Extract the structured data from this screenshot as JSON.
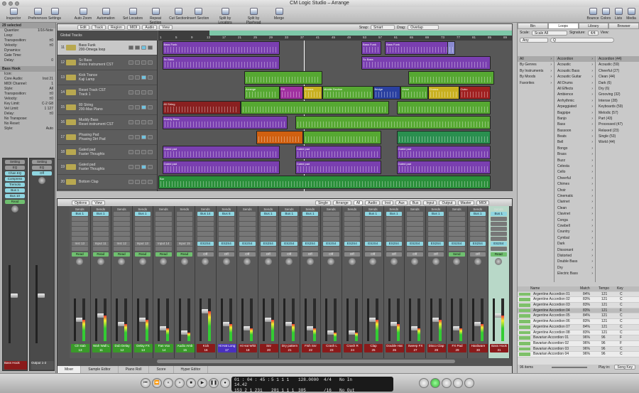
{
  "window": {
    "title": "CM Logic Studio – Arrange"
  },
  "toolbar": {
    "left": [
      "Inspector",
      "Preferences",
      "Settings",
      "Auto Zoom",
      "Automation",
      "Set Locators",
      "Repeat Section",
      "Cut Section",
      "Insert Section",
      "Split by Locators",
      "Split by Playhead",
      "Merge"
    ],
    "right": [
      "Bounce",
      "Colors",
      "Lists",
      "Media"
    ]
  },
  "inspector": {
    "region_header": "29 selected",
    "region_params": [
      [
        "Quantize:",
        "1/16-Note"
      ],
      [
        "Loop:",
        ""
      ],
      [
        "Transposition:",
        "±0"
      ],
      [
        "Velocity:",
        "±0"
      ],
      [
        "Dynamics:",
        ""
      ],
      [
        "Gate Time:",
        ""
      ],
      [
        "Delay:",
        "0"
      ]
    ],
    "track_header": "Bass Hook",
    "track_params": [
      [
        "Icon:",
        ""
      ],
      [
        "Core Audio:",
        "Inst 21"
      ],
      [
        "MIDI Channel:",
        "1"
      ],
      [
        "Style:",
        "All"
      ],
      [
        "Transposition:",
        "±0"
      ],
      [
        "Velocity:",
        "±0"
      ],
      [
        "Key Limit:",
        "C-2  G8"
      ],
      [
        "Vel Limit:",
        "1  127"
      ],
      [
        "Delay:",
        "±0"
      ],
      [
        "No Transpose:",
        ""
      ],
      [
        "No Reset:",
        ""
      ],
      [
        "Style:",
        "Auto"
      ]
    ],
    "strip_buttons": [
      "Setting",
      "EQ",
      "Chan EQ",
      "Compress",
      "Tremolo",
      "Bus 1",
      "Bus 10",
      "Read",
      "Off"
    ],
    "strip_names": [
      "Bass Hook",
      "Output 1-2"
    ]
  },
  "arrange": {
    "menus": [
      "Edit",
      "Track",
      "Region",
      "MIDI",
      "Audio",
      "View"
    ],
    "snap_label": "Snap:",
    "snap_value": "Smart",
    "drag_label": "Drag:",
    "drag_value": "Overlap",
    "global_tracks": "Global Tracks",
    "ruler": [
      "1",
      "5",
      "9",
      "13",
      "17",
      "21",
      "25",
      "29",
      "33",
      "37",
      "41",
      "45",
      "49",
      "53",
      "57",
      "61",
      "65",
      "69",
      "73",
      "77",
      "81",
      "85",
      "89"
    ],
    "tracks": [
      {
        "num": "11",
        "name": "Bass Funk",
        "sub": "200-Omega loop",
        "sel": true
      },
      {
        "num": "12",
        "name": "Sc Bass",
        "sub": "Retro Instrument CST"
      },
      {
        "num": "13",
        "name": "Kick Trance",
        "sub": "Kaji Lamp"
      },
      {
        "num": "14",
        "name": "Reset Track CST",
        "sub": "Track 1"
      },
      {
        "num": "15",
        "name": "80 String",
        "sub": "200-Max Plano"
      },
      {
        "num": "16",
        "name": "Muddy Bass",
        "sub": "Reset instrument CST"
      },
      {
        "num": "17",
        "name": "Phasing Pad",
        "sub": "Phasing Dirt Pad"
      },
      {
        "num": "18",
        "name": "Gated pad",
        "sub": "Faster Thoughts"
      },
      {
        "num": "19",
        "name": "Gated pad",
        "sub": "Faster Thoughts"
      },
      {
        "num": "20",
        "name": "Bottom Clap",
        "sub": ""
      }
    ],
    "regions": [
      {
        "track": 0,
        "start": 53,
        "len": 5,
        "color": "#7a3fb0",
        "label": "Bass Funk"
      },
      {
        "track": 0,
        "start": 59,
        "len": 18,
        "color": "#7a3fb0",
        "label": "Bass Funk"
      },
      {
        "track": 0,
        "start": 2,
        "len": 30,
        "color": "#7a3fb0",
        "label": "Bass Funk"
      },
      {
        "track": 0,
        "start": 75,
        "len": 2,
        "color": "#8a8ad0",
        "label": ""
      },
      {
        "track": 1,
        "start": 2,
        "len": 30,
        "color": "#7a3fb0",
        "label": "Sc Bass"
      },
      {
        "track": 1,
        "start": 53,
        "len": 33,
        "color": "#7a3fb0",
        "label": "Sc Bass"
      },
      {
        "track": 2,
        "start": 23,
        "len": 20,
        "color": "#56a832",
        "label": ""
      },
      {
        "track": 2,
        "start": 65,
        "len": 22,
        "color": "#56a832",
        "label": ""
      },
      {
        "track": 3,
        "start": 23,
        "len": 9,
        "color": "#56a832",
        "label": "Arrange"
      },
      {
        "track": 3,
        "start": 32,
        "len": 6,
        "color": "#a030a0",
        "label": "Fill"
      },
      {
        "track": 3,
        "start": 38,
        "len": 5,
        "color": "#c8b020",
        "label": "Chorus"
      },
      {
        "track": 3,
        "start": 43,
        "len": 13,
        "color": "#56a832",
        "label": "Middle Section"
      },
      {
        "track": 3,
        "start": 56,
        "len": 7,
        "color": "#2a40a0",
        "label": "Bridge"
      },
      {
        "track": 3,
        "start": 63,
        "len": 7,
        "color": "#56a832",
        "label": "Verse"
      },
      {
        "track": 3,
        "start": 70,
        "len": 8,
        "color": "#c8b020",
        "label": "Chorus"
      },
      {
        "track": 3,
        "start": 78,
        "len": 8,
        "color": "#a02020",
        "label": "Outro"
      },
      {
        "track": 4,
        "start": 2,
        "len": 20,
        "color": "#8a2020",
        "label": "80 String"
      },
      {
        "track": 4,
        "start": 22,
        "len": 38,
        "color": "#56a832",
        "label": ""
      },
      {
        "track": 4,
        "start": 62,
        "len": 24,
        "color": "#56a832",
        "label": ""
      },
      {
        "track": 5,
        "start": 2,
        "len": 32,
        "color": "#7a3fb0",
        "label": "Muddy Bass"
      },
      {
        "track": 5,
        "start": 36,
        "len": 50,
        "color": "#56a832",
        "label": ""
      },
      {
        "track": 6,
        "start": 26,
        "len": 12,
        "color": "#d06010",
        "label": ""
      },
      {
        "track": 6,
        "start": 38,
        "len": 20,
        "color": "#56a832",
        "label": ""
      },
      {
        "track": 6,
        "start": 62,
        "len": 24,
        "color": "#2a8f4f",
        "label": ""
      },
      {
        "track": 7,
        "start": 2,
        "len": 30,
        "color": "#7a3fb0",
        "label": "Gated pad"
      },
      {
        "track": 7,
        "start": 36,
        "len": 22,
        "color": "#7a3fb0",
        "label": "Gated pad"
      },
      {
        "track": 7,
        "start": 62,
        "len": 24,
        "color": "#7a3fb0",
        "label": "Gated pad"
      },
      {
        "track": 8,
        "start": 2,
        "len": 30,
        "color": "#7a3fb0",
        "label": "Gated pad"
      },
      {
        "track": 8,
        "start": 36,
        "len": 22,
        "color": "#7a3fb0",
        "label": "Gated pad"
      },
      {
        "track": 8,
        "start": 62,
        "len": 24,
        "color": "#7a3fb0",
        "label": "Gated pad"
      },
      {
        "track": 9,
        "start": 1,
        "len": 85,
        "color": "#2a8f3a",
        "label": "Bar"
      }
    ]
  },
  "mixer": {
    "menus": [
      "Options",
      "View"
    ],
    "filters": [
      "Single",
      "Arrange",
      "All",
      "Audio",
      "Inst",
      "Aux",
      "Bus",
      "Input",
      "Output",
      "Master",
      "MIDI"
    ],
    "sends_label": "Sends",
    "tabs": [
      "Mixer",
      "Sample Editor",
      "Piano Roll",
      "Score",
      "Hyper Editor"
    ],
    "channels": [
      {
        "name": "Clr stab",
        "num": "13",
        "color": "#3a9a2a",
        "bus": "Bus 1",
        "io": "Inst 13",
        "auto": "Read",
        "level": 0.5
      },
      {
        "name": "Wah Wall L",
        "num": "11",
        "color": "#3a9a2a",
        "bus": "Bus 1",
        "io": "Input 11",
        "auto": "Read",
        "level": 0.6
      },
      {
        "name": "Dub Delay",
        "num": "12",
        "color": "#3a9a2a",
        "bus": "",
        "io": "Inst 12",
        "auto": "Read",
        "level": 0.4
      },
      {
        "name": "Delay FX",
        "num": "13",
        "color": "#3a9a2a",
        "bus": "Bus 1",
        "io": "Input 13",
        "auto": "Read",
        "level": 0.5
      },
      {
        "name": "Fan Vox",
        "num": "14",
        "color": "#3a9a2a",
        "bus": "",
        "io": "Input 14",
        "auto": "Read",
        "level": 0.3
      },
      {
        "name": "Audio Amb",
        "num": "15",
        "color": "#3a9a2a",
        "bus": "",
        "io": "Input 15",
        "auto": "Read",
        "level": 0.2
      },
      {
        "name": "Kick",
        "num": "16",
        "color": "#8a1a1a",
        "bus": "Bus 14",
        "io": "ES2S4",
        "auto": "Off",
        "level": 0.7
      },
      {
        "name": "Hi Hat Long",
        "num": "17",
        "color": "#4a30c0",
        "bus": "Bus 8",
        "io": "ES2S4",
        "auto": "Off",
        "level": 0.4
      },
      {
        "name": "Hi Hat Whit",
        "num": "18",
        "color": "#8a1a1a",
        "bus": "",
        "io": "ES2S4",
        "auto": "Off",
        "level": 0.3
      },
      {
        "name": "Snr",
        "num": "20",
        "color": "#8a1a1a",
        "bus": "Bus 1",
        "io": "ES2S4",
        "auto": "Off",
        "level": 0.5
      },
      {
        "name": "Dry pattern",
        "num": "21",
        "color": "#8a1a1a",
        "bus": "Bus 1",
        "io": "ES2S4",
        "auto": "Off",
        "level": 0.4
      },
      {
        "name": "Fish Snr",
        "num": "22",
        "color": "#8a1a1a",
        "bus": "Bus 1",
        "io": "ES2S4",
        "auto": "Off",
        "level": 0.3
      },
      {
        "name": "Crash L",
        "num": "23",
        "color": "#8a1a1a",
        "bus": "",
        "io": "ES2S4",
        "auto": "Off",
        "level": 0.2
      },
      {
        "name": "Crash R",
        "num": "24",
        "color": "#8a1a1a",
        "bus": "",
        "io": "ES2S4",
        "auto": "Off",
        "level": 0.2
      },
      {
        "name": "Clap",
        "num": "25",
        "color": "#8a1a1a",
        "bus": "Bus 1",
        "io": "ES2S4",
        "auto": "Off",
        "level": 0.5
      },
      {
        "name": "Double Hat",
        "num": "26",
        "color": "#8a1a1a",
        "bus": "Bus 1",
        "io": "ES2S4",
        "auto": "Off",
        "level": 0.4
      },
      {
        "name": "Sweep FX",
        "num": "27",
        "color": "#8a1a1a",
        "bus": "",
        "io": "ES2S4",
        "auto": "Off",
        "level": 0.3
      },
      {
        "name": "Disco Clap",
        "num": "28",
        "color": "#8a1a1a",
        "bus": "Bus 1",
        "io": "ES2S4",
        "auto": "Off",
        "level": 0.5
      },
      {
        "name": "FX Pad",
        "num": "29",
        "color": "#8a1a1a",
        "bus": "",
        "io": "ES2S4",
        "auto": "Send",
        "level": 0.3
      },
      {
        "name": "Hardware",
        "num": "30",
        "color": "#8a1a1a",
        "bus": "Bus 1",
        "io": "ES2S4",
        "auto": "Off",
        "level": 0.4
      },
      {
        "name": "Bass Hook",
        "num": "31",
        "color": "#8a1a1a",
        "bus": "Bus 1",
        "io": "ES2S4",
        "auto": "Read",
        "level": 0.6,
        "sel": true
      }
    ]
  },
  "browser": {
    "tabs": [
      "Bin",
      "Loops",
      "Library",
      "Browser"
    ],
    "scale_label": "Scale:",
    "scale_value": "Scale All",
    "signature_label": "Signature:",
    "signature_value": "4/4",
    "view_label": "View:",
    "view_value": "Any",
    "search_placeholder": "Q",
    "col1": [
      "All",
      "By Genres",
      "By Instruments",
      "By Moods",
      "Favorites"
    ],
    "col2": [
      "Accordion",
      "Acoustic",
      "Acoustic Bass",
      "Acoustic Guitar",
      "All Drums",
      "All Effects",
      "Ambience",
      "Arrhythmic",
      "Arpeggiated",
      "Bagpipe",
      "Banjo",
      "Bass",
      "Bassoon",
      "Beats",
      "Bell",
      "Bongo",
      "Brass",
      "Buzz",
      "Celesta",
      "Cello",
      "Cheerful",
      "Chimes",
      "Choir",
      "Cinematic",
      "Clarinet",
      "Clean",
      "Clavinet",
      "Conga",
      "Cowbell",
      "Country",
      "Cymbal",
      "Dark",
      "Dissonant",
      "Distorted",
      "Double Bass",
      "Dry",
      "Electric Bass"
    ],
    "col3": [
      "Accordion (44)",
      "Acoustic (59)",
      "Cheerful (27)",
      "Clean (44)",
      "Dark (6)",
      "Dry (6)",
      "Grooving (32)",
      "Intense (28)",
      "Keyboards (59)",
      "Melodic (57)",
      "Part (43)",
      "Processed (47)",
      "Relaxed (23)",
      "Single (53)",
      "World (44)"
    ],
    "results_headers": [
      "Name",
      "Match",
      "Tempo",
      "Key"
    ],
    "results": [
      [
        "Argentine Accordion 01",
        "84%",
        "121",
        "C"
      ],
      [
        "Argentine Accordion 02",
        "83%",
        "121",
        "C"
      ],
      [
        "Argentine Accordion 03",
        "83%",
        "121",
        "C"
      ],
      [
        "Argentine Accordion 04",
        "83%",
        "121",
        "F"
      ],
      [
        "Argentine Accordion 05",
        "84%",
        "121",
        "C"
      ],
      [
        "Argentine Accordion 06",
        "83%",
        "121",
        "C"
      ],
      [
        "Argentine Accordion 07",
        "84%",
        "121",
        "C"
      ],
      [
        "Argentine Accordion 08",
        "83%",
        "121",
        "C"
      ],
      [
        "Bavarian Accordion 01",
        "96%",
        "96",
        "F"
      ],
      [
        "Bavarian Accordion 02",
        "96%",
        "96",
        "F"
      ],
      [
        "Bavarian Accordion 03",
        "96%",
        "96",
        "C"
      ],
      [
        "Bavarian Accordion 04",
        "96%",
        "96",
        "C"
      ]
    ],
    "items_count": "96 items",
    "play_in_label": "Play in:",
    "play_in_value": "Song Key"
  },
  "transport": {
    "smpte": "01 : 04 : 45 : 14.42",
    "bars": "153  2  1  231",
    "pos": "5  1  1  1",
    "pos2": "201  1  1  1",
    "tempo": "128.0000",
    "division": "305",
    "sig": "4/4",
    "sig2": "/16",
    "in": "No In",
    "out": "No Out",
    "buttons": [
      "go-to-start",
      "rewind-small",
      "rewind",
      "forward",
      "stop",
      "play",
      "pause",
      "record"
    ]
  }
}
